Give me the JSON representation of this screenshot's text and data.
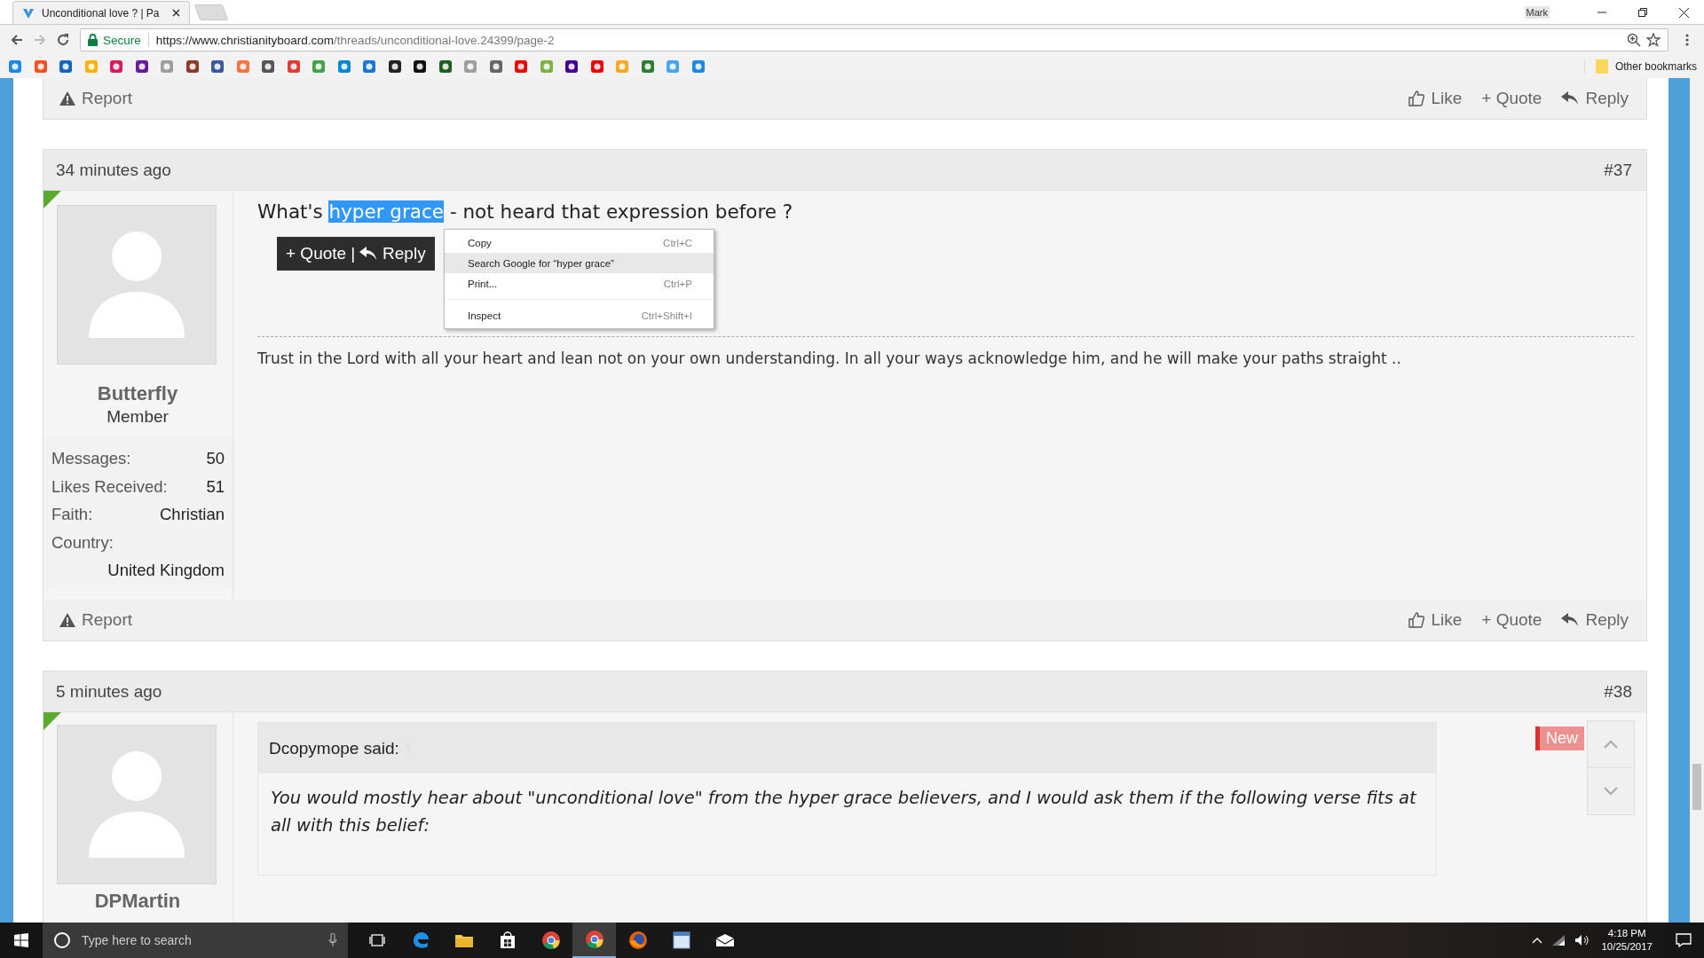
{
  "browser": {
    "tab": {
      "title": "Unconditional love ? | Pa",
      "selected": true
    },
    "user": "Mark",
    "security": "Secure",
    "url_host": "https://www.christianityboard.com",
    "url_path": "/threads/unconditional-love.24399/page-2",
    "other_bookmarks": "Other bookmarks"
  },
  "prev_footer": {
    "report": "Report",
    "like": "Like",
    "quote": "+ Quote",
    "reply": "Reply"
  },
  "posts": [
    {
      "kind": "message",
      "time": "34 minutes ago",
      "number": "#37",
      "user": "Butterfly",
      "role": "Member",
      "stats": [
        {
          "label": "Messages:",
          "value": "50"
        },
        {
          "label": "Likes Received:",
          "value": "51"
        },
        {
          "label": "Faith:",
          "value": "Christian"
        },
        {
          "label": "Country:",
          "value": "United Kingdom"
        }
      ],
      "text_before": "What's ",
      "selection": "hyper grace",
      "text_after": " - not heard that expression before ?",
      "popup": {
        "quote": "+ Quote",
        "separator": "|",
        "reply": "Reply"
      },
      "signature": "Trust in the Lord with all your heart and lean not on your own understanding. In all your ways acknowledge him, and he will make your paths straight ..",
      "footer": {
        "report": "Report",
        "like": "Like",
        "quote": "+ Quote",
        "reply": "Reply"
      }
    },
    {
      "kind": "quote",
      "time": "5 minutes ago",
      "number": "#38",
      "user": "DPMartin",
      "quote_author": "Dcopymope said:",
      "quote_text": "You would mostly hear about \"unconditional love\" from the hyper grace believers, and I would ask them if the following verse fits at all with this belief:",
      "badge": "New"
    }
  ],
  "context_menu": {
    "items": [
      {
        "kind": "item",
        "label": "Copy",
        "shortcut": "Ctrl+C",
        "highlighted": false
      },
      {
        "kind": "item",
        "label": "Search Google for “hyper grace”",
        "highlighted": true
      },
      {
        "kind": "item",
        "label": "Print...",
        "shortcut": "Ctrl+P",
        "highlighted": false
      },
      {
        "kind": "separator"
      },
      {
        "kind": "item",
        "label": "Inspect",
        "shortcut": "Ctrl+Shift+I",
        "highlighted": false
      }
    ]
  },
  "taskbar": {
    "search_placeholder": "Type here to search",
    "apps": [
      {
        "kind": "task-view",
        "active": false
      },
      {
        "kind": "edge",
        "active": false
      },
      {
        "kind": "folder",
        "active": false
      },
      {
        "kind": "store",
        "active": false
      },
      {
        "kind": "chrome",
        "active": false
      },
      {
        "kind": "chrome",
        "active": true
      },
      {
        "kind": "firefox",
        "active": false
      },
      {
        "kind": "window",
        "active": false
      },
      {
        "kind": "mail",
        "active": false
      }
    ],
    "time": "4:18 PM",
    "date": "10/25/2017"
  }
}
